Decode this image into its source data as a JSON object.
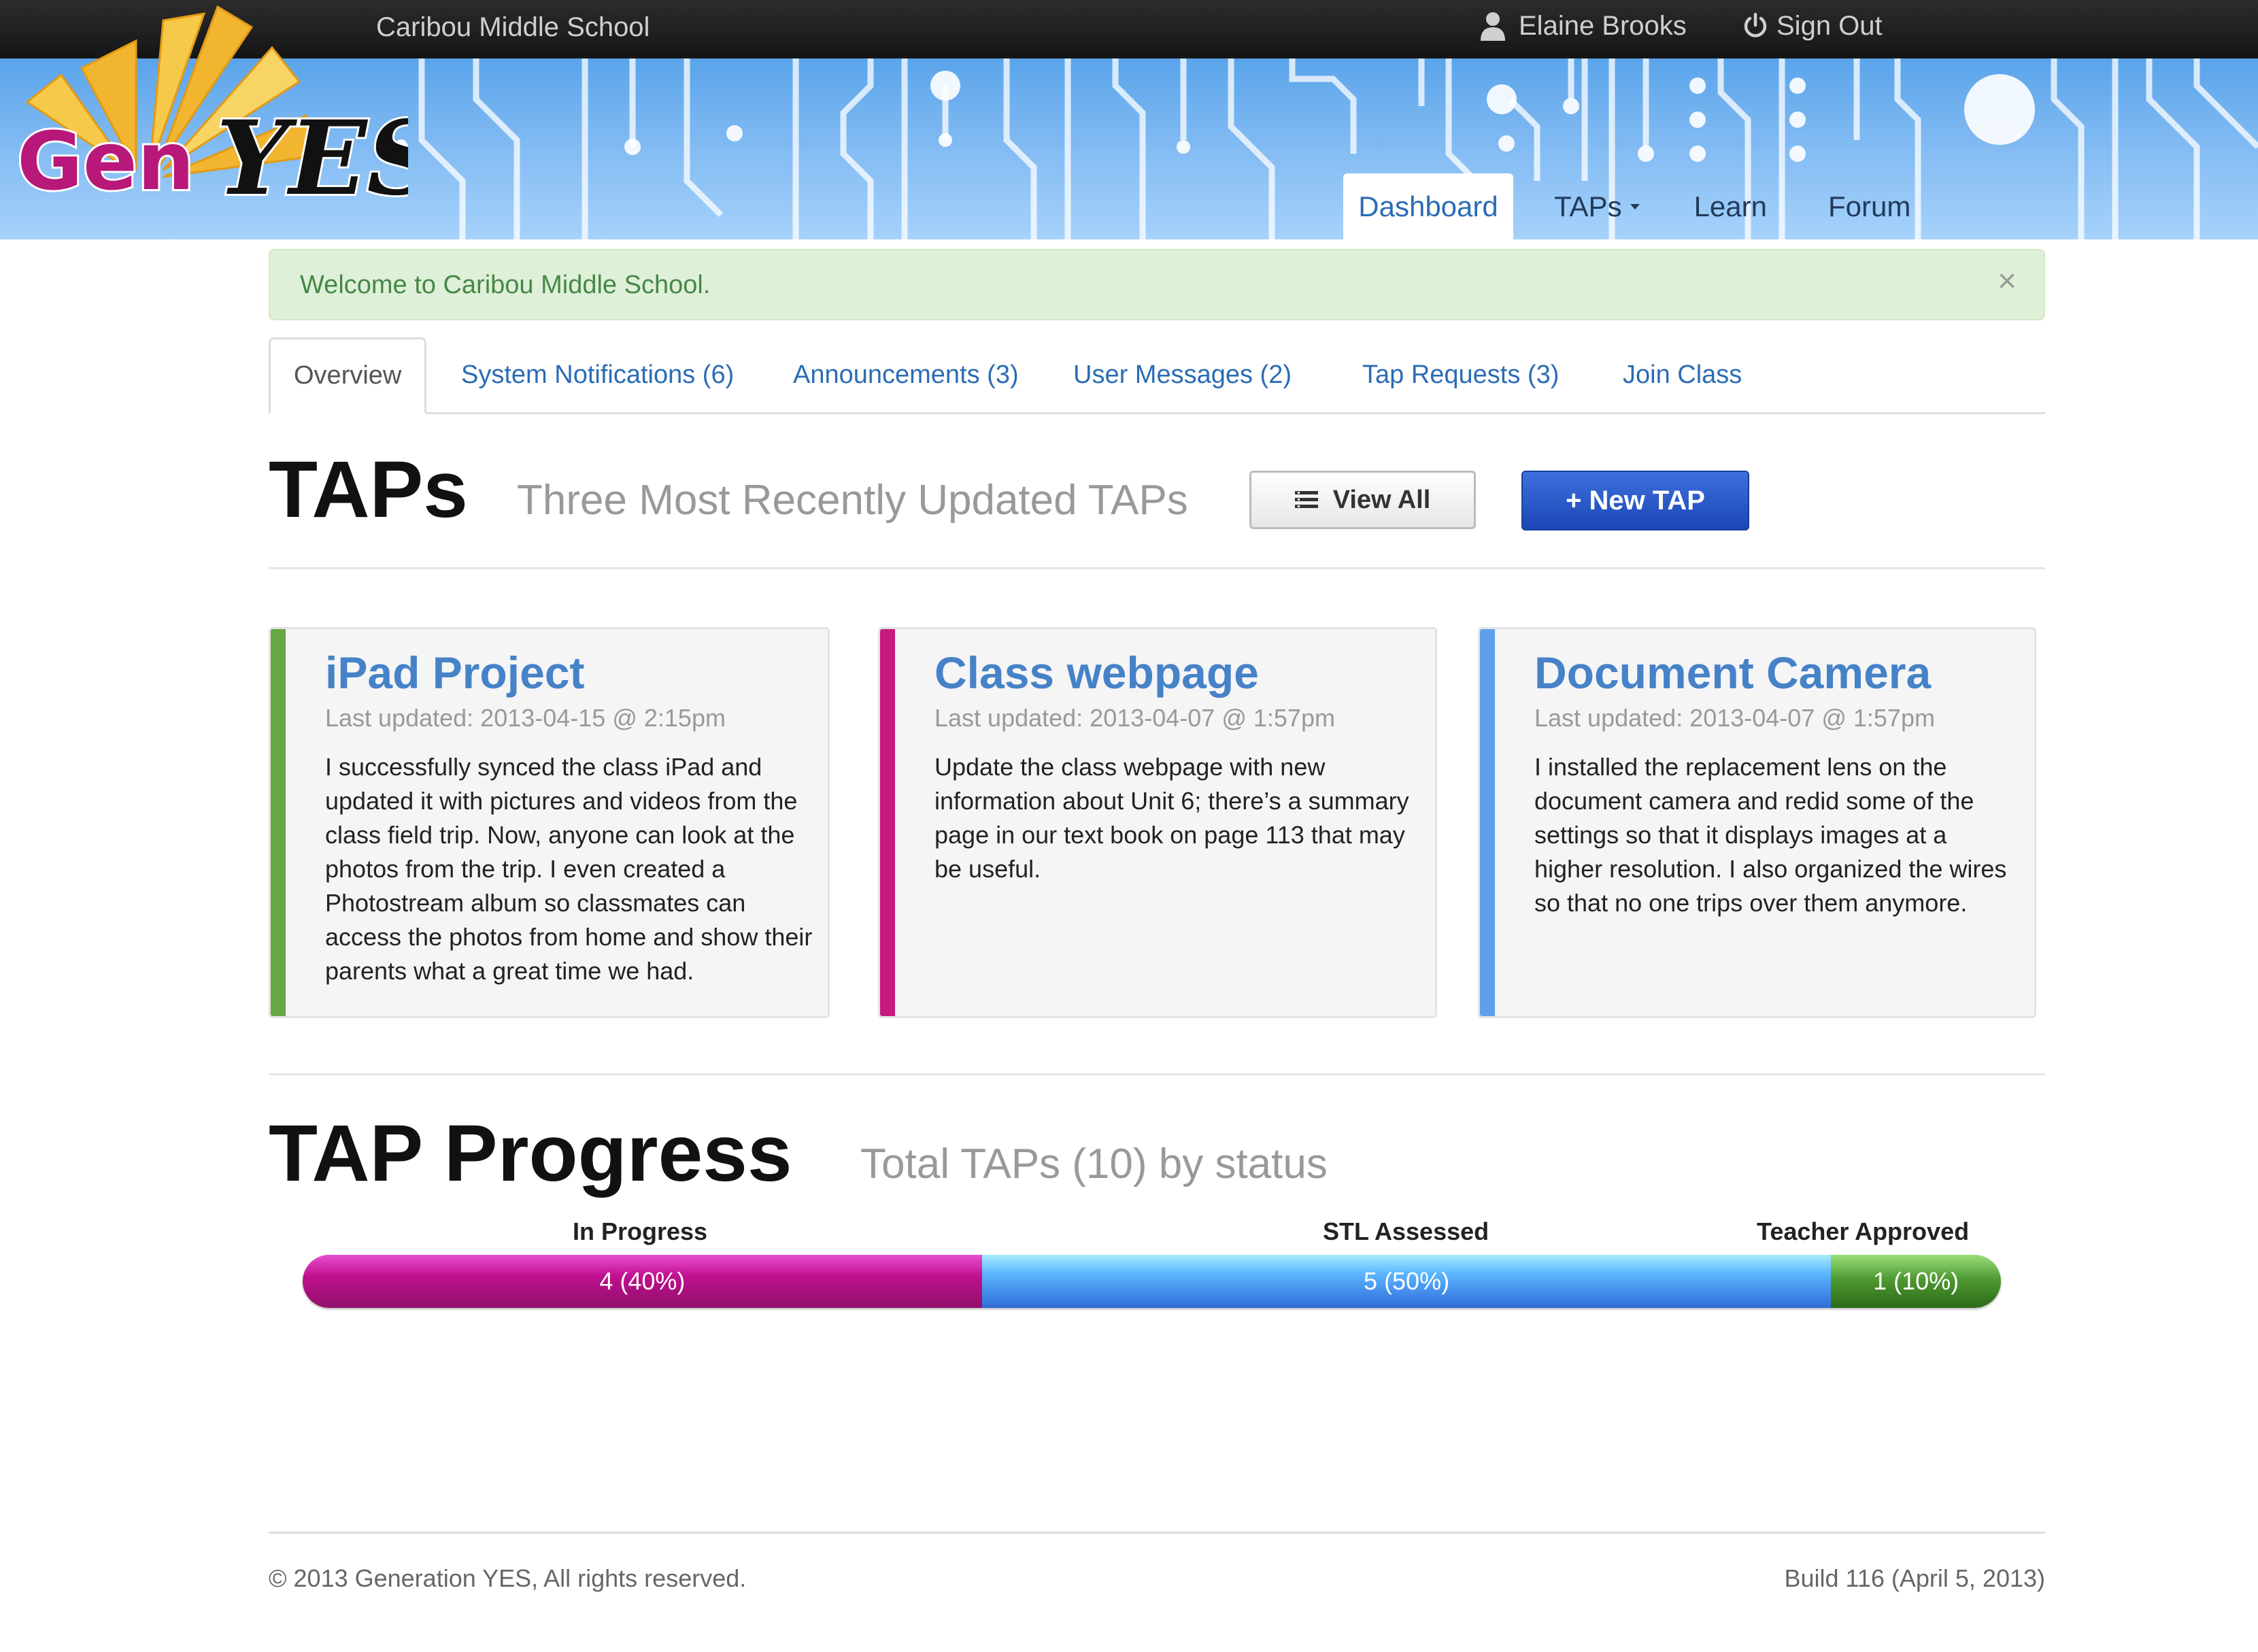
{
  "header": {
    "school_name": "Caribou Middle School",
    "user_name": "Elaine Brooks",
    "sign_out": "Sign Out"
  },
  "logo": {
    "text_gen": "Gen",
    "text_yes": "YES"
  },
  "nav": {
    "items": [
      {
        "label": "Dashboard",
        "active": true
      },
      {
        "label": "TAPs",
        "has_dropdown": true
      },
      {
        "label": "Learn"
      },
      {
        "label": "Forum"
      }
    ]
  },
  "alert": {
    "message": "Welcome to Caribou Middle School.",
    "close": "×"
  },
  "tabs": [
    {
      "label": "Overview",
      "active": true
    },
    {
      "label": "System Notifications (6)"
    },
    {
      "label": "Announcements (3)"
    },
    {
      "label": "User Messages (2)"
    },
    {
      "label": "Tap Requests (3)"
    },
    {
      "label": "Join Class"
    }
  ],
  "taps_section": {
    "title": "TAPs",
    "subtitle": "Three Most Recently Updated TAPs",
    "view_all_label": "View All",
    "new_tap_label": "+ New TAP"
  },
  "cards": [
    {
      "title": "iPad Project",
      "updated": "Last updated: 2013-04-15 @ 2:15pm",
      "body": "I successfully synced the class iPad and updated it with pictures and videos from the class field trip. Now, anyone can look at the photos from the trip. I even created a Photostream album so classmates can access the photos from home and show their parents what a great time we had.",
      "accent": "#66a843"
    },
    {
      "title": "Class webpage",
      "updated": "Last updated: 2013-04-07 @ 1:57pm",
      "body": "Update the class webpage with new information about Unit 6; there’s a sum­mary page in our text book on page 113 that may be useful.",
      "accent": "#c8197e"
    },
    {
      "title": "Document Camera",
      "updated": "Last updated: 2013-04-07 @ 1:57pm",
      "body": "I installed the replacement lens on the document camera and redid some of the settings so that it displays images at a higher resolution. I also organized the wires so that no one trips over them anymore.",
      "accent": "#5ea1ea"
    }
  ],
  "progress": {
    "title": "TAP Progress",
    "subtitle": "Total TAPs (10) by status",
    "segments": [
      {
        "label": "In Progress",
        "text": "4 (40%)",
        "value": 4,
        "color": "#c0108f"
      },
      {
        "label": "STL Assessed",
        "text": "5 (50%)",
        "value": 5,
        "color": "#4a90e8"
      },
      {
        "label": "Teacher Approved",
        "text": "1 (10%)",
        "value": 1,
        "color": "#4f9a32"
      }
    ]
  },
  "footer": {
    "copyright": "© 2013 Generation YES, All rights reserved.",
    "build": "Build 116 (April 5, 2013)"
  }
}
